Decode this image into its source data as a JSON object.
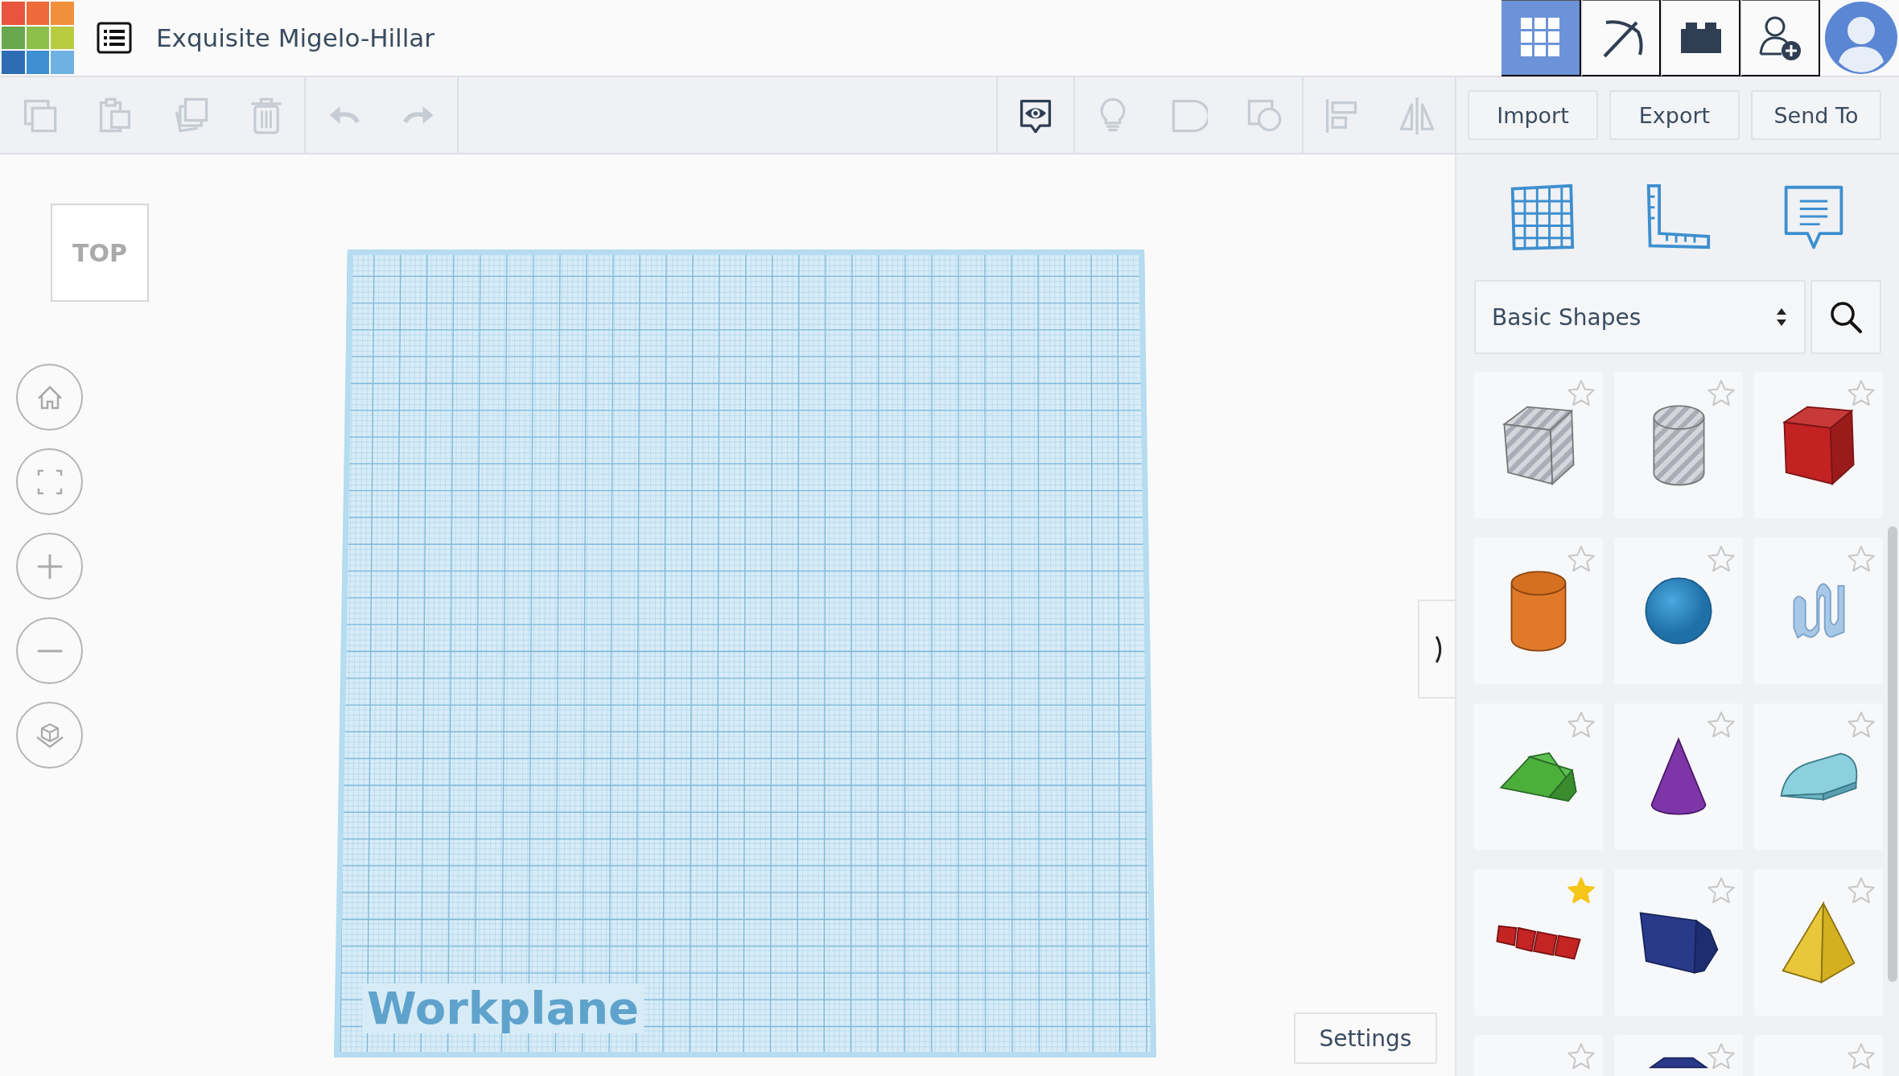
{
  "window": {
    "title": "Exquisite Migelo-Hillar"
  },
  "app_switcher": [
    {
      "kind": "grid",
      "selected": true
    },
    {
      "kind": "pickaxe",
      "selected": false
    },
    {
      "kind": "brick",
      "selected": false
    }
  ],
  "toolbar": [
    {
      "kind": "copy",
      "disabled": true
    },
    {
      "kind": "paste",
      "disabled": true
    },
    {
      "kind": "duplicate",
      "disabled": true
    },
    {
      "kind": "delete",
      "disabled": true
    },
    {
      "kind": "undo",
      "disabled": true
    },
    {
      "kind": "redo",
      "disabled": true
    },
    {
      "kind": "notes",
      "disabled": false
    },
    {
      "kind": "bulb",
      "disabled": true
    },
    {
      "kind": "solid",
      "disabled": true
    },
    {
      "kind": "hole",
      "disabled": true
    },
    {
      "kind": "align",
      "disabled": true
    },
    {
      "kind": "mirror",
      "disabled": true
    }
  ],
  "actions": [
    "Import",
    "Export",
    "Send To"
  ],
  "view_cube": {
    "label": "TOP"
  },
  "workplane": {
    "label": "Workplane"
  },
  "settings_button": "Settings",
  "shape_library": {
    "value": "Basic Shapes"
  },
  "shapes": [
    {
      "kind": "box_hole",
      "favorite": false
    },
    {
      "kind": "cylinder_hole",
      "favorite": false
    },
    {
      "kind": "box",
      "favorite": false
    },
    {
      "kind": "cylinder",
      "favorite": false
    },
    {
      "kind": "sphere",
      "favorite": false
    },
    {
      "kind": "scribble",
      "favorite": false
    },
    {
      "kind": "roof",
      "favorite": false
    },
    {
      "kind": "cone",
      "favorite": false
    },
    {
      "kind": "round_roof",
      "favorite": false
    },
    {
      "kind": "text",
      "favorite": true
    },
    {
      "kind": "prism",
      "favorite": false
    },
    {
      "kind": "pyramid",
      "favorite": false
    },
    {
      "kind": "blank",
      "favorite": false
    },
    {
      "kind": "polygon",
      "favorite": false
    },
    {
      "kind": "blank",
      "favorite": false
    }
  ]
}
